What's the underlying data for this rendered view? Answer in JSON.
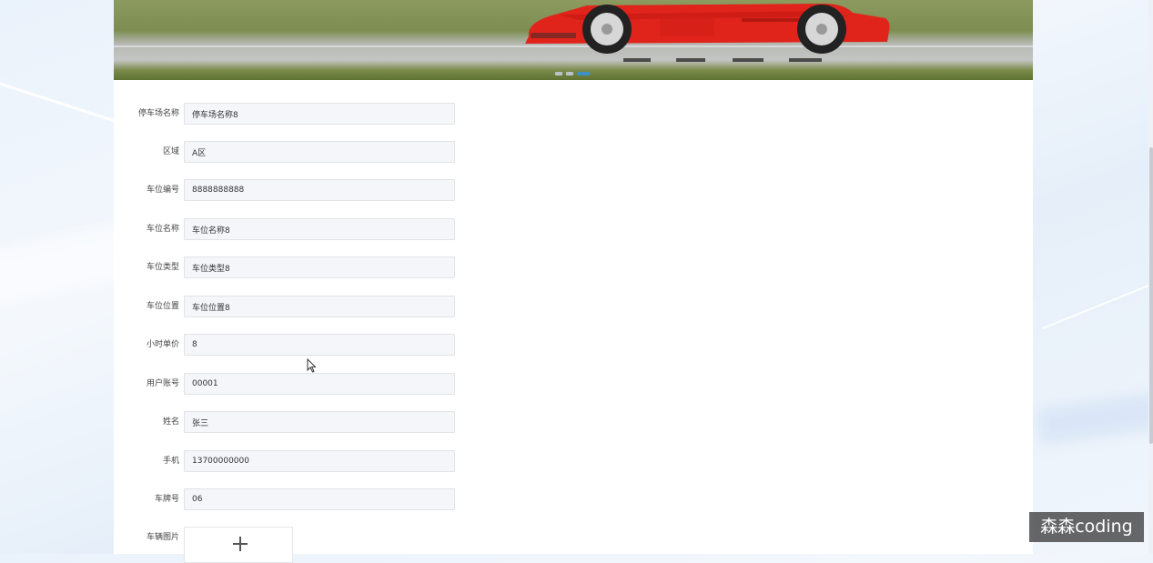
{
  "form": {
    "fields": [
      {
        "label": "停车场名称",
        "value": "停车场名称8"
      },
      {
        "label": "区域",
        "value": "A区"
      },
      {
        "label": "车位编号",
        "value": "8888888888"
      },
      {
        "label": "车位名称",
        "value": "车位名称8"
      },
      {
        "label": "车位类型",
        "value": "车位类型8"
      },
      {
        "label": "车位位置",
        "value": "车位位置8"
      },
      {
        "label": "小时单价",
        "value": "8"
      },
      {
        "label": "用户账号",
        "value": "00001"
      },
      {
        "label": "姓名",
        "value": "张三"
      },
      {
        "label": "手机",
        "value": "13700000000"
      },
      {
        "label": "车牌号",
        "value": "06"
      }
    ],
    "upload": {
      "label": "车辆图片",
      "icon": "plus-icon"
    }
  },
  "carousel": {
    "dot_count": 3,
    "active_index": 2
  },
  "watermark": "森森coding",
  "colors": {
    "car_red": "#e0241b",
    "dot_active": "#3e8fc7"
  }
}
